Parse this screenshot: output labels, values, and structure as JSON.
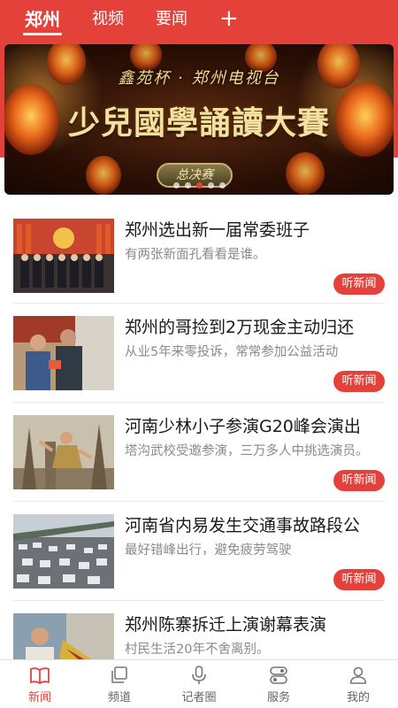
{
  "colors": {
    "accent": "#e5413b",
    "text": "#1a1a1a",
    "muted": "#8a8a8a"
  },
  "tabs": [
    {
      "label": "郑州",
      "active": true
    },
    {
      "label": "视频",
      "active": false
    },
    {
      "label": "要闻",
      "active": false
    }
  ],
  "add_tab_label": "+",
  "banner": {
    "subtitle": "鑫苑杯 · 郑州电视台",
    "title": "少兒國學誦讀大賽",
    "badge": "总决赛",
    "slide_count": 5,
    "active_slide": 3
  },
  "news": [
    {
      "title": "郑州选出新一届常委班子",
      "desc": "有两张新面孔看看是谁。",
      "button": "听新闻",
      "thumb": "meeting-photo"
    },
    {
      "title": "郑州的哥捡到2万现金主动归还",
      "desc": "从业5年来零投诉，常常参加公益活动",
      "button": "听新闻",
      "thumb": "handover-photo"
    },
    {
      "title": "河南少林小子参演G20峰会演出",
      "desc": "塔沟武校受邀参演，三万多人中挑选演员。",
      "button": "听新闻",
      "thumb": "shaolin-photo"
    },
    {
      "title": "河南省内易发生交通事故路段公",
      "desc": "最好错峰出行，避免疲劳驾驶",
      "button": "听新闻",
      "thumb": "traffic-photo"
    },
    {
      "title": "郑州陈寨拆迁上演谢幕表演",
      "desc": "村民生活20年不舍离别。",
      "button": "听新闻",
      "thumb": "demolition-photo"
    }
  ],
  "bottom_nav": [
    {
      "label": "新闻",
      "icon": "book-icon",
      "active": true
    },
    {
      "label": "频道",
      "icon": "layers-icon",
      "active": false
    },
    {
      "label": "记者圈",
      "icon": "microphone-icon",
      "active": false
    },
    {
      "label": "服务",
      "icon": "toggle-icon",
      "active": false
    },
    {
      "label": "我的",
      "icon": "person-icon",
      "active": false
    }
  ]
}
